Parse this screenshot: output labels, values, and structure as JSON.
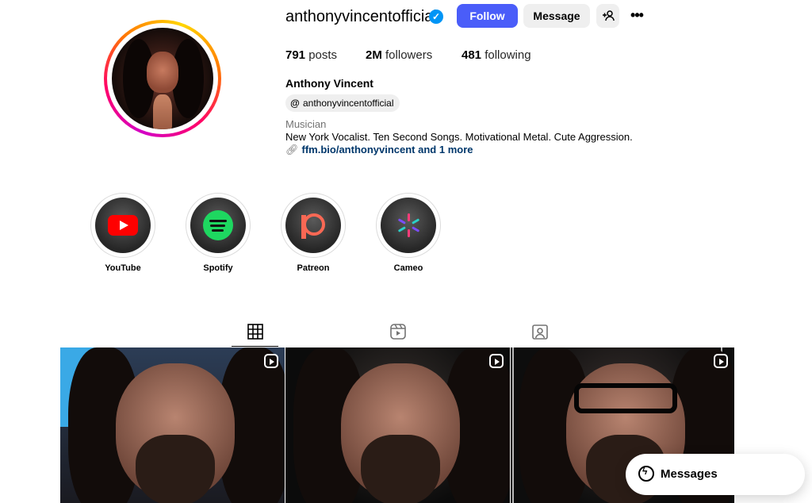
{
  "profile": {
    "username": "anthonyvincentofficial",
    "verified": true,
    "full_name": "Anthony Vincent",
    "threads_handle": "anthonyvincentofficial",
    "category": "Musician",
    "bio": "New York Vocalist. Ten Second Songs. Motivational Metal. Cute Aggression.",
    "link_text": "ffm.bio/anthonyvincent and 1 more"
  },
  "actions": {
    "follow_label": "Follow",
    "message_label": "Message"
  },
  "stats": {
    "posts_count": "791",
    "posts_label": "posts",
    "followers_count": "2M",
    "followers_label": "followers",
    "following_count": "481",
    "following_label": "following"
  },
  "highlights": [
    {
      "label": "YouTube",
      "icon": "youtube-icon"
    },
    {
      "label": "Spotify",
      "icon": "spotify-icon"
    },
    {
      "label": "Patreon",
      "icon": "patreon-icon"
    },
    {
      "label": "Cameo",
      "icon": "cameo-icon"
    }
  ],
  "tabs": [
    {
      "icon": "grid-icon",
      "active": true
    },
    {
      "icon": "reels-icon",
      "active": false
    },
    {
      "icon": "tagged-icon",
      "active": false
    }
  ],
  "messages": {
    "label": "Messages"
  },
  "colors": {
    "follow_button": "#4a5df9",
    "link": "#00376b",
    "verified": "#0095f6"
  }
}
